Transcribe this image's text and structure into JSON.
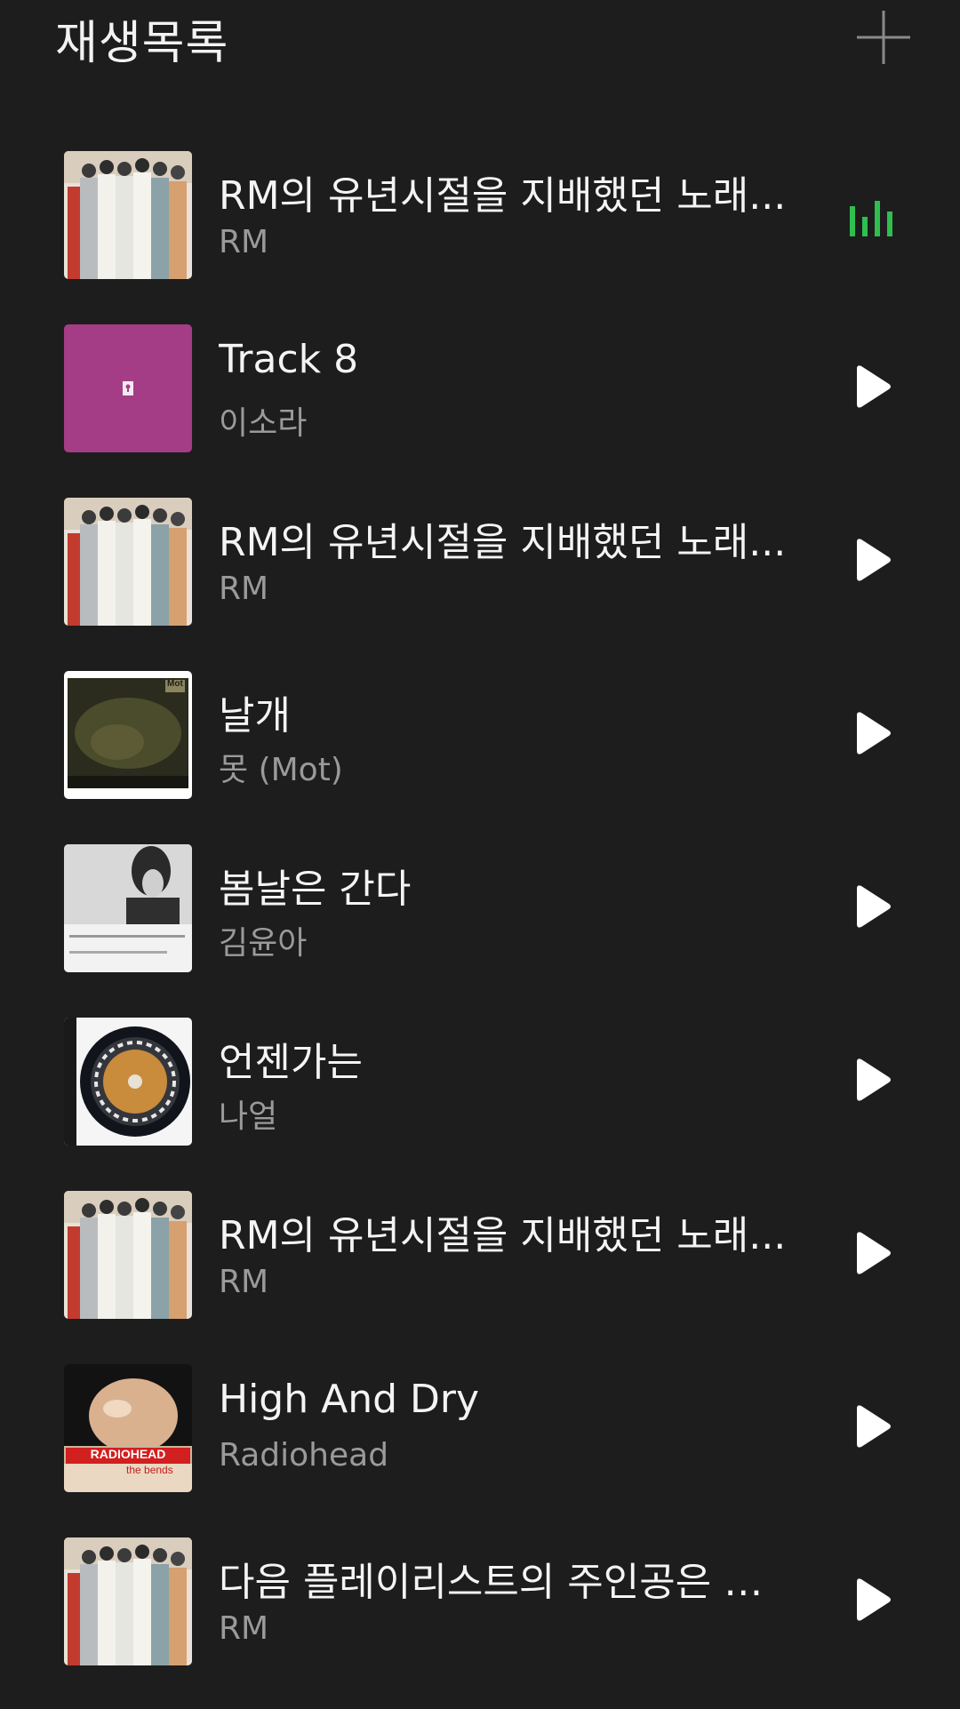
{
  "header": {
    "title": "재생목록",
    "add_icon": "plus-icon"
  },
  "colors": {
    "background": "#1d1d1d",
    "now_playing": "#2fbf4f",
    "artist_text": "#9a9a9a"
  },
  "playlist": {
    "items": [
      {
        "title": "RM의 유년시절을 지배했던 노래...",
        "artist": "RM",
        "state": "playing",
        "art": "group-photo"
      },
      {
        "title": "Track 8",
        "artist": "이소라",
        "state": "idle",
        "art": "magenta-keyhole"
      },
      {
        "title": "RM의 유년시절을 지배했던 노래...",
        "artist": "RM",
        "state": "idle",
        "art": "group-photo"
      },
      {
        "title": "날개",
        "artist": "못 (Mot)",
        "state": "idle",
        "art": "dark-forest"
      },
      {
        "title": "봄날은 간다",
        "artist": "김윤아",
        "state": "idle",
        "art": "portrait-bw"
      },
      {
        "title": "언젠가는",
        "artist": "나얼",
        "state": "idle",
        "art": "vinyl-pattern"
      },
      {
        "title": "RM의 유년시절을 지배했던 노래...",
        "artist": "RM",
        "state": "idle",
        "art": "group-photo"
      },
      {
        "title": "High And Dry",
        "artist": "Radiohead",
        "state": "idle",
        "art": "radiohead-bends"
      },
      {
        "title": "다음 플레이리스트의 주인공은 누...",
        "artist": "RM",
        "state": "idle",
        "art": "group-photo"
      }
    ]
  },
  "album_art_text": {
    "radiohead_logo": "RADIOHEAD",
    "radiohead_sub": "the bends",
    "mot_logo": "Mot"
  }
}
